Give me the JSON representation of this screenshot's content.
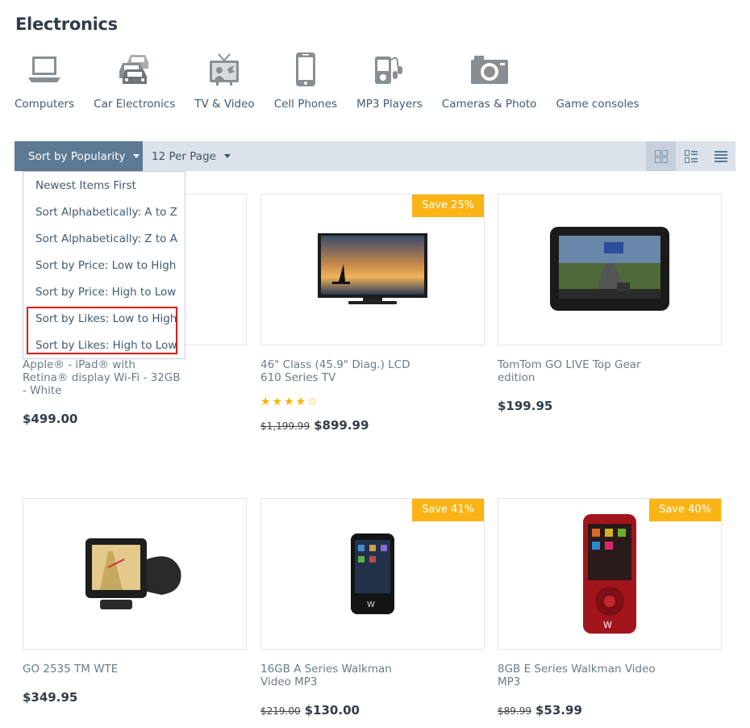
{
  "page": {
    "title": "Electronics"
  },
  "categories": [
    {
      "label": "Computers",
      "icon": "laptop-icon"
    },
    {
      "label": "Car Electronics",
      "icon": "cars-icon"
    },
    {
      "label": "TV & Video",
      "icon": "tv-icon"
    },
    {
      "label": "Cell Phones",
      "icon": "phone-icon"
    },
    {
      "label": "MP3 Players",
      "icon": "mp3-player-icon"
    },
    {
      "label": "Cameras & Photo",
      "icon": "camera-icon"
    },
    {
      "label": "Game consoles",
      "icon": ""
    }
  ],
  "toolbar": {
    "sort_label": "Sort by Popularity",
    "per_page_label": "12 Per Page",
    "views": [
      "grid-large-view-icon",
      "grid-list-view-icon",
      "list-view-icon"
    ]
  },
  "sort_menu": {
    "items": [
      "Newest Items First",
      "Sort Alphabetically: A to Z",
      "Sort Alphabetically: Z to A",
      "Sort by Price: Low to High",
      "Sort by Price: High to Low",
      "Sort by Likes: Low to High",
      "Sort by Likes: High to Low"
    ],
    "highlight_color": "#e01b1b"
  },
  "products": [
    {
      "name": "Apple® - iPad® with Retina® display Wi-Fi - 32GB - White",
      "price": "$499.00",
      "old_price": "",
      "badge": "",
      "stars": ""
    },
    {
      "name": "46\" Class (45.9\" Diag.) LCD 610 Series TV",
      "price": "$899.99",
      "old_price": "$1,199.99",
      "badge": "Save 25%",
      "stars": "★★★★☆"
    },
    {
      "name": "TomTom GO LIVE Top Gear edition",
      "price": "$199.95",
      "old_price": "",
      "badge": "",
      "stars": ""
    },
    {
      "name": "GO 2535 TM WTE",
      "price": "$349.95",
      "old_price": "",
      "badge": "",
      "stars": ""
    },
    {
      "name": "16GB A Series Walkman Video MP3",
      "price": "$130.00",
      "old_price": "$219.00",
      "badge": "Save 41%",
      "stars": ""
    },
    {
      "name": "8GB E Series Walkman Video MP3",
      "price": "$53.99",
      "old_price": "$89.99",
      "badge": "Save 40%",
      "stars": ""
    }
  ],
  "colors": {
    "accent": "#5d7993",
    "toolbar_bg": "#dbe2ea",
    "badge": "#fbb416",
    "star": "#f7b500"
  }
}
